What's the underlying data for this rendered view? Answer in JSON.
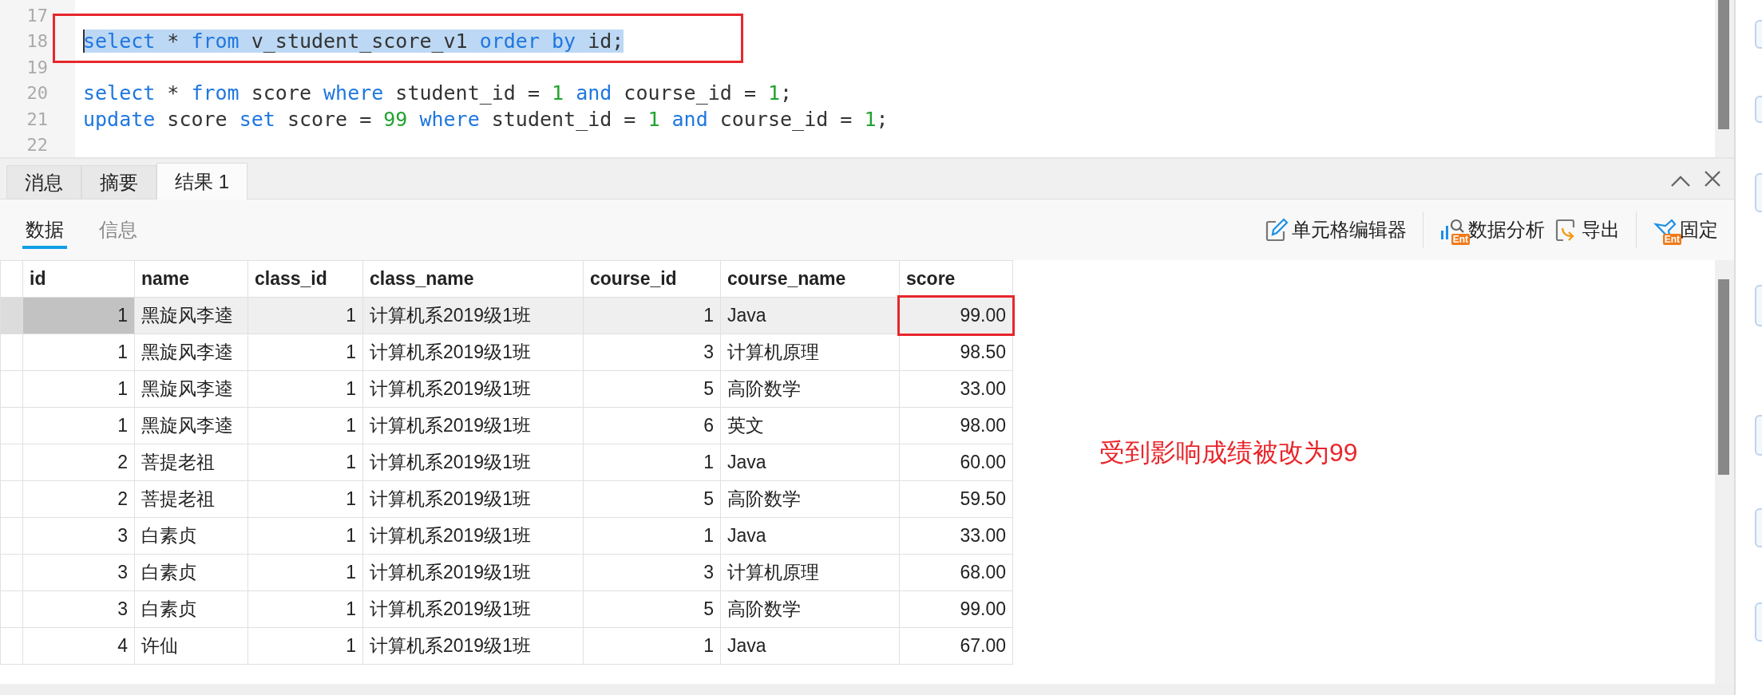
{
  "editor": {
    "lines": [
      {
        "number": "17"
      },
      {
        "number": "18",
        "selected": true,
        "marked": true,
        "tokens": [
          {
            "kind": "keyword",
            "text": "select"
          },
          {
            "kind": "plain",
            "text": " * "
          },
          {
            "kind": "keyword",
            "text": "from"
          },
          {
            "kind": "plain",
            "text": " v_student_score_v1 "
          },
          {
            "kind": "keyword",
            "text": "order by"
          },
          {
            "kind": "plain",
            "text": " id;"
          }
        ]
      },
      {
        "number": "19"
      },
      {
        "number": "20",
        "tokens": [
          {
            "kind": "keyword",
            "text": "select"
          },
          {
            "kind": "plain",
            "text": " * "
          },
          {
            "kind": "keyword",
            "text": "from"
          },
          {
            "kind": "plain",
            "text": " score "
          },
          {
            "kind": "keyword",
            "text": "where"
          },
          {
            "kind": "plain",
            "text": " student_id = "
          },
          {
            "kind": "number",
            "text": "1"
          },
          {
            "kind": "keyword",
            "text": " and"
          },
          {
            "kind": "plain",
            "text": " course_id = "
          },
          {
            "kind": "number",
            "text": "1"
          },
          {
            "kind": "plain",
            "text": ";"
          }
        ]
      },
      {
        "number": "21",
        "tokens": [
          {
            "kind": "keyword",
            "text": "update"
          },
          {
            "kind": "plain",
            "text": " score "
          },
          {
            "kind": "keyword",
            "text": "set"
          },
          {
            "kind": "plain",
            "text": " score = "
          },
          {
            "kind": "number",
            "text": "99"
          },
          {
            "kind": "keyword",
            "text": " where"
          },
          {
            "kind": "plain",
            "text": " student_id = "
          },
          {
            "kind": "number",
            "text": "1"
          },
          {
            "kind": "keyword",
            "text": " and"
          },
          {
            "kind": "plain",
            "text": " course_id = "
          },
          {
            "kind": "number",
            "text": "1"
          },
          {
            "kind": "plain",
            "text": ";"
          }
        ]
      },
      {
        "number": "22"
      }
    ]
  },
  "result_tabs": [
    {
      "label": "消息",
      "selected": false
    },
    {
      "label": "摘要",
      "selected": false
    },
    {
      "label": "结果 1",
      "selected": true
    }
  ],
  "view_tabs": [
    {
      "label": "数据",
      "selected": true
    },
    {
      "label": "信息",
      "selected": false
    }
  ],
  "toolbar": [
    {
      "kind": "edit",
      "label": "单元格编辑器"
    },
    {
      "kind": "analysis",
      "label": "数据分析",
      "badge": "Ent"
    },
    {
      "kind": "export",
      "label": "导出"
    },
    {
      "kind": "pin",
      "label": "固定",
      "badge": "Ent"
    }
  ],
  "table": {
    "columns": [
      "id",
      "name",
      "class_id",
      "class_name",
      "course_id",
      "course_name",
      "score"
    ],
    "rows": [
      {
        "selected": true,
        "marked": true,
        "cells": [
          "1",
          "黑旋风李逵",
          "1",
          "计算机系2019级1班",
          "1",
          "Java",
          "99.00"
        ]
      },
      {
        "selected": false,
        "cells": [
          "1",
          "黑旋风李逵",
          "1",
          "计算机系2019级1班",
          "3",
          "计算机原理",
          "98.50"
        ]
      },
      {
        "selected": false,
        "cells": [
          "1",
          "黑旋风李逵",
          "1",
          "计算机系2019级1班",
          "5",
          "高阶数学",
          "33.00"
        ]
      },
      {
        "selected": false,
        "cells": [
          "1",
          "黑旋风李逵",
          "1",
          "计算机系2019级1班",
          "6",
          "英文",
          "98.00"
        ]
      },
      {
        "selected": false,
        "cells": [
          "2",
          "菩提老祖",
          "1",
          "计算机系2019级1班",
          "1",
          "Java",
          "60.00"
        ]
      },
      {
        "selected": false,
        "cells": [
          "2",
          "菩提老祖",
          "1",
          "计算机系2019级1班",
          "5",
          "高阶数学",
          "59.50"
        ]
      },
      {
        "selected": false,
        "cells": [
          "3",
          "白素贞",
          "1",
          "计算机系2019级1班",
          "1",
          "Java",
          "33.00"
        ]
      },
      {
        "selected": false,
        "cells": [
          "3",
          "白素贞",
          "1",
          "计算机系2019级1班",
          "3",
          "计算机原理",
          "68.00"
        ]
      },
      {
        "selected": false,
        "cells": [
          "3",
          "白素贞",
          "1",
          "计算机系2019级1班",
          "5",
          "高阶数学",
          "99.00"
        ]
      },
      {
        "selected": false,
        "cells": [
          "4",
          "许仙",
          "1",
          "计算机系2019级1班",
          "1",
          "Java",
          "67.00"
        ]
      }
    ]
  },
  "note": "受到影响成绩被改为99"
}
